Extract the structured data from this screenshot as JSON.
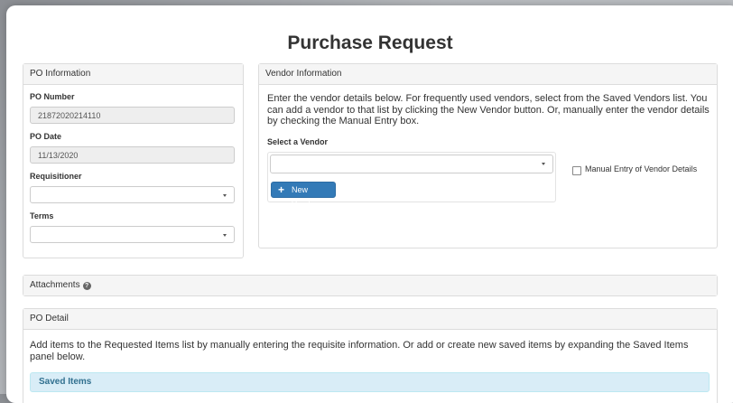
{
  "title": "Purchase Request",
  "po_info": {
    "heading": "PO Information",
    "po_number_label": "PO Number",
    "po_number": "21872020214110",
    "po_date_label": "PO Date",
    "po_date": "11/13/2020",
    "requisitioner_label": "Requisitioner",
    "requisitioner": "",
    "terms_label": "Terms",
    "terms": ""
  },
  "vendor_info": {
    "heading": "Vendor Information",
    "instructions": "Enter the vendor details below. For frequently used vendors, select from the Saved Vendors list. You can add a vendor to that list by clicking the New Vendor button. Or, manually enter the vendor details by checking the Manual Entry box.",
    "select_label": "Select a Vendor",
    "selected_vendor": "",
    "new_vendor_label": "New Vendor",
    "manual_entry_label": "Manual Entry of Vendor Details",
    "manual_entry_checked": false
  },
  "attachments": {
    "heading": "Attachments"
  },
  "po_detail": {
    "heading": "PO Detail",
    "instructions": "Add items to the Requested Items list by manually entering the requisite information. Or add or create new saved items by expanding the Saved Items panel below.",
    "saved_items_label": "Saved Items"
  },
  "colors": {
    "primary": "#337ab7",
    "info_bg": "#d9edf7",
    "info_text": "#31708f",
    "panel_heading_bg": "#f5f5f5"
  },
  "icons": {
    "attachments_help": "question-circle-icon",
    "new_vendor": "plus-icon",
    "select_caret": "caret-down-icon"
  }
}
